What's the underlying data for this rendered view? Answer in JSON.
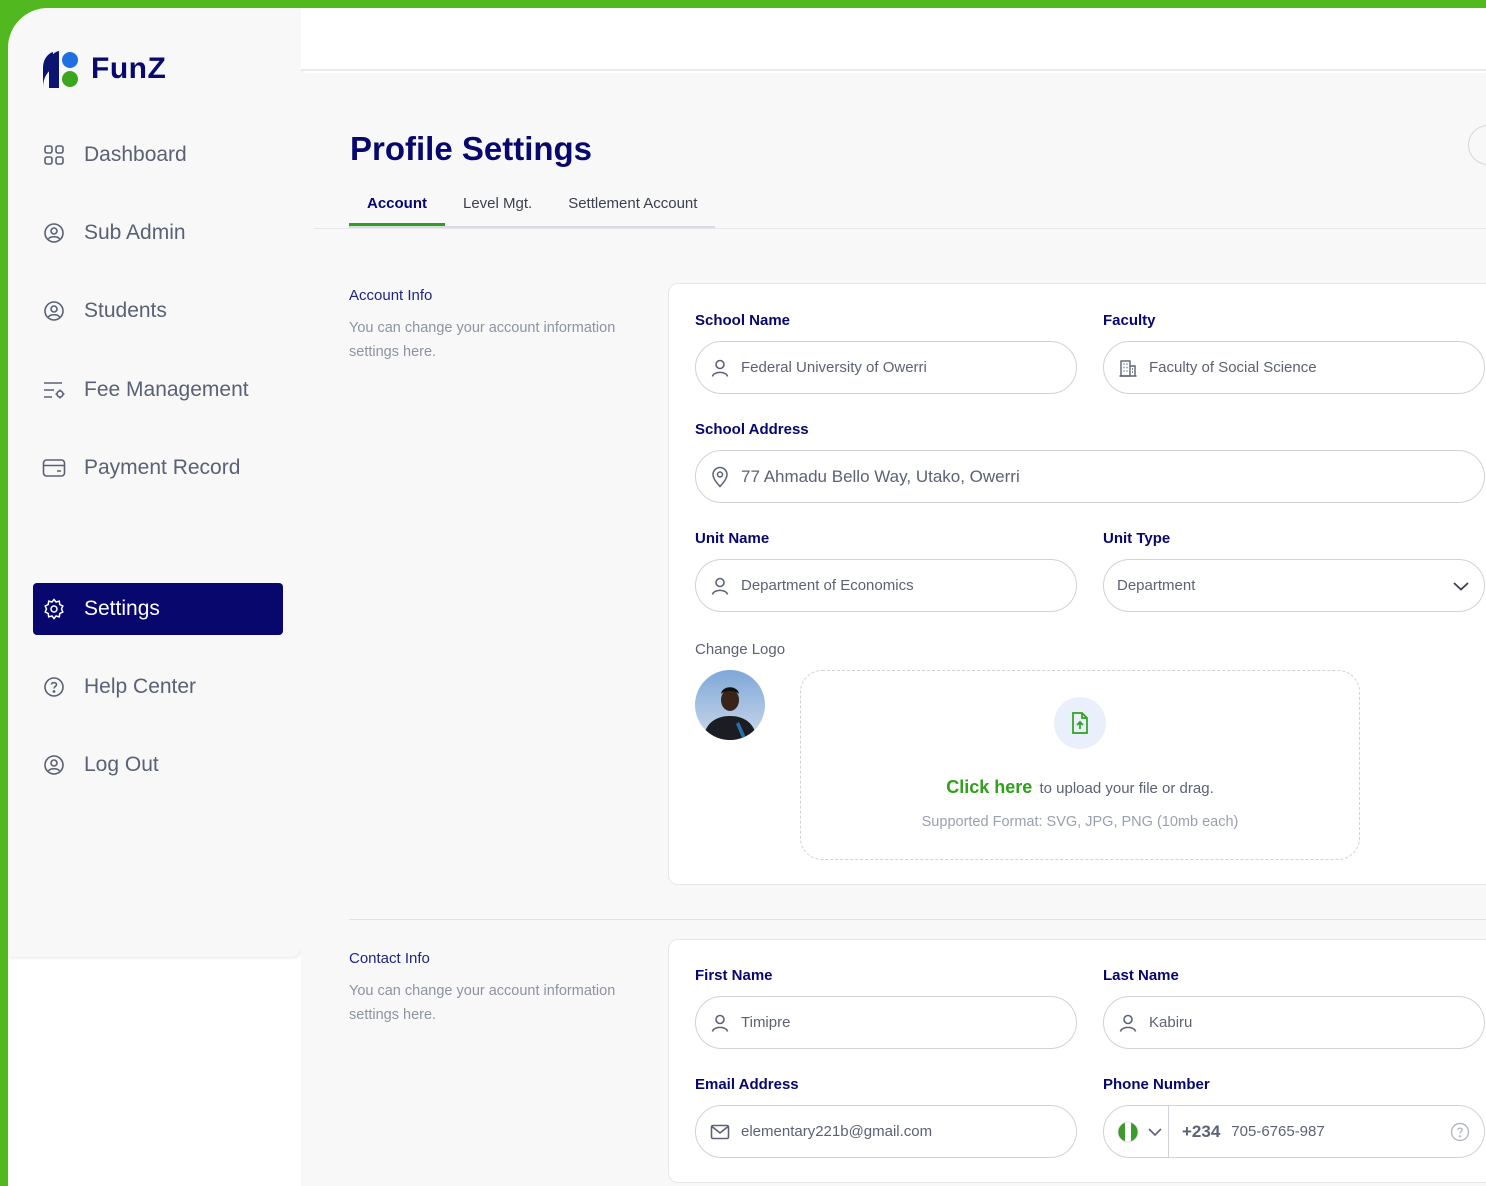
{
  "app": {
    "name": "FunZ"
  },
  "sidebar": {
    "items": [
      {
        "label": "Dashboard",
        "icon": "grid-icon"
      },
      {
        "label": "Sub Admin",
        "icon": "user-circle-icon"
      },
      {
        "label": "Students",
        "icon": "user-circle-icon"
      },
      {
        "label": "Fee Management",
        "icon": "list-settings-icon"
      },
      {
        "label": "Payment Record",
        "icon": "card-icon"
      },
      {
        "label": "Settings",
        "icon": "gear-icon",
        "active": true
      },
      {
        "label": "Help Center",
        "icon": "help-icon"
      },
      {
        "label": "Log Out",
        "icon": "user-circle-icon"
      }
    ]
  },
  "page": {
    "title": "Profile Settings",
    "tabs": [
      {
        "label": "Account",
        "active": true
      },
      {
        "label": "Level Mgt."
      },
      {
        "label": "Settlement Account"
      }
    ]
  },
  "account_info": {
    "title": "Account Info",
    "description": "You can change  your account information settings here.",
    "school_name": {
      "label": "School Name",
      "value": "Federal University of Owerri"
    },
    "faculty": {
      "label": "Faculty",
      "value": "Faculty of Social Science"
    },
    "school_address": {
      "label": "School Address",
      "value": "77 Ahmadu Bello Way, Utako, Owerri"
    },
    "unit_name": {
      "label": "Unit Name",
      "value": "Department of Economics"
    },
    "unit_type": {
      "label": "Unit Type",
      "value": "Department"
    },
    "change_logo": {
      "label": "Change Logo",
      "click_text": "Click here",
      "upload_text": "to upload your file or drag.",
      "formats": "Supported Format: SVG, JPG, PNG (10mb each)"
    }
  },
  "contact_info": {
    "title": "Contact Info",
    "description": "You can change  your account information settings here.",
    "first_name": {
      "label": "First Name",
      "value": "Timipre"
    },
    "last_name": {
      "label": "Last Name",
      "value": "Kabiru"
    },
    "email": {
      "label": "Email Address",
      "value": "elementary221b@gmail.com"
    },
    "phone": {
      "label": "Phone Number",
      "code": "+234",
      "value": "705-6765-987"
    }
  },
  "colors": {
    "brand_navy": "#07076e",
    "accent_green": "#2fa01b",
    "frame_green": "#52b81f"
  }
}
